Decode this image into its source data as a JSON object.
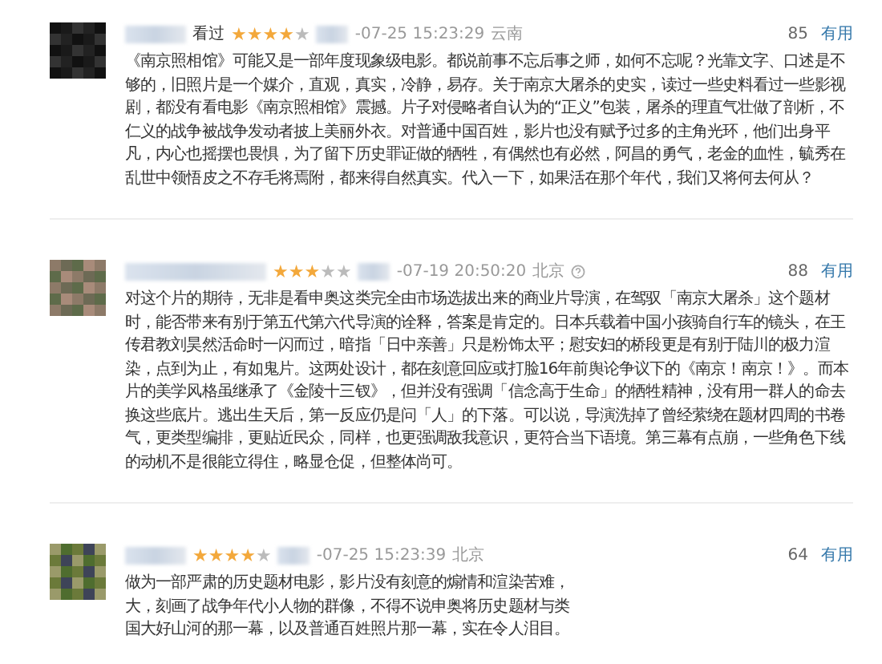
{
  "reviews": [
    {
      "status": "看过",
      "stars": 4,
      "time": "-07-25 15:23:29",
      "location": "云南",
      "help_icon": false,
      "votes": "85",
      "useful": "有用",
      "text": "《南京照相馆》可能又是一部年度现象级电影。都说前事不忘后事之师，如何不忘呢？光靠文字、口述是不够的，旧照片是一个媒介，直观，真实，冷静，易存。关于南京大屠杀的史实，读过一些史料看过一些影视剧，都没有看电影《南京照相馆》震撼。片子对侵略者自认为的“正义”包装，屠杀的理直气壮做了剖析，不仁义的战争被战争发动者披上美丽外衣。对普通中国百姓，影片也没有赋予过多的主角光环，他们出身平凡，内心也摇摆也畏惧，为了留下历史罪证做的牺牲，有偶然也有必然，阿昌的勇气，老金的血性，毓秀在乱世中领悟皮之不存毛将焉附，都来得自然真实。代入一下，如果活在那个年代，我们又将何去何从？"
    },
    {
      "stars": 3,
      "time": "-07-19 20:50:20",
      "location": "北京",
      "help_icon": true,
      "votes": "88",
      "useful": "有用",
      "text": "对这个片的期待，无非是看申奥这类完全由市场选拔出来的商业片导演，在驾驭「南京大屠杀」这个题材时，能否带来有别于第五代第六代导演的诠释，答案是肯定的。日本兵载着中国小孩骑自行车的镜头，在王传君教刘昊然活命时一闪而过，暗指「日中亲善」只是粉饰太平；慰安妇的桥段更是有别于陆川的极力渲染，点到为止，有如鬼片。这两处设计，都在刻意回应或打脸16年前舆论争议下的《南京！南京！》。而本片的美学风格虽继承了《金陵十三钗》，但并没有强调「信念高于生命」的牺牲精神，没有用一群人的命去换这些底片。逃出生天后，第一反应仍是问「人」的下落。可以说，导演洗掉了曾经萦绕在题材四周的书卷气，更类型编排，更贴近民众，同样，也更强调敌我意识，更符合当下语境。第三幕有点崩，一些角色下线的动机不是很能立得住，略显仓促，但整体尚可。"
    },
    {
      "stars": 4,
      "time": "-07-25 15:23:39",
      "location": "北京",
      "help_icon": false,
      "votes": "64",
      "useful": "有用",
      "text_lines": [
        "做为一部严肃的历史题材电影，影片没有刻意的煽情和渲染苦难，",
        "大，刻画了战争年代小人物的群像，不得不说申奥将历史题材与类",
        "国大好山河的那一幕，以及普通百姓照片那一幕，实在令人泪目。"
      ]
    }
  ]
}
